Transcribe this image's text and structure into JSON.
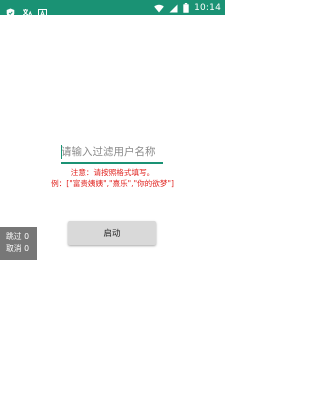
{
  "status_bar": {
    "time": "10:14",
    "background_color": "#1a9274",
    "left_icons": [
      "shield-icon",
      "translate-icon",
      "text-a-icon"
    ],
    "right_icons": [
      "wifi-icon",
      "signal-icon",
      "battery-icon"
    ]
  },
  "filter": {
    "placeholder": "请输入过滤用户名称",
    "value": ""
  },
  "notice": {
    "line1": "注意：请按照格式填写。",
    "line2": "例：[\"富贵姨姨\",\"熹乐\",\"你的欲梦\"]",
    "color": "#e0201c"
  },
  "start_button": {
    "label": "启动"
  },
  "counters": {
    "skip_label": "跳过",
    "skip_value": "0",
    "cancel_label": "取消",
    "cancel_value": "0"
  },
  "accent_color": "#1a9274"
}
